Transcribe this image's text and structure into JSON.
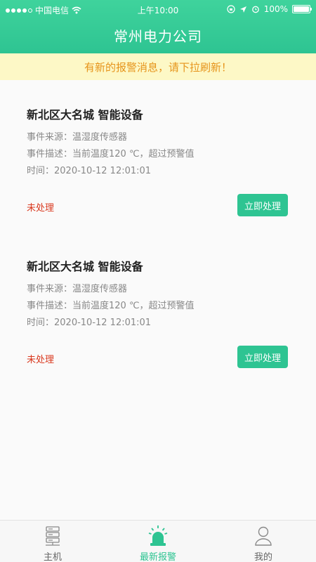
{
  "status_bar": {
    "carrier": "中国电信",
    "time": "上午10:00",
    "battery": "100%",
    "battery_level": 1.0
  },
  "header": {
    "title": "常州电力公司"
  },
  "banner": {
    "text": "有新的报警消息，请下拉刷新！"
  },
  "alerts": [
    {
      "title": "新北区大名城  智能设备",
      "source": "事件来源：温湿度传感器",
      "description": "事件描述：当前温度120 ℃，超过预警值",
      "time": "时间：2020-10-12 12:01:01",
      "status": "未处理",
      "action_label": "立即处理"
    },
    {
      "title": "新北区大名城  智能设备",
      "source": "事件来源：温湿度传感器",
      "description": "事件描述：当前温度120 ℃，超过预警值",
      "time": "时间：2020-10-12 12:01:01",
      "status": "未处理",
      "action_label": "立即处理"
    }
  ],
  "tabbar": {
    "items": [
      {
        "label": "主机",
        "icon": "server-icon"
      },
      {
        "label": "最新报警",
        "icon": "alarm-light-icon"
      },
      {
        "label": "我的",
        "icon": "user-icon"
      }
    ],
    "active_index": 1
  },
  "colors": {
    "accent": "#2ec492",
    "banner_bg": "#fdf8c6",
    "banner_text": "#e6941b",
    "status_unhandled": "#d9381e"
  }
}
